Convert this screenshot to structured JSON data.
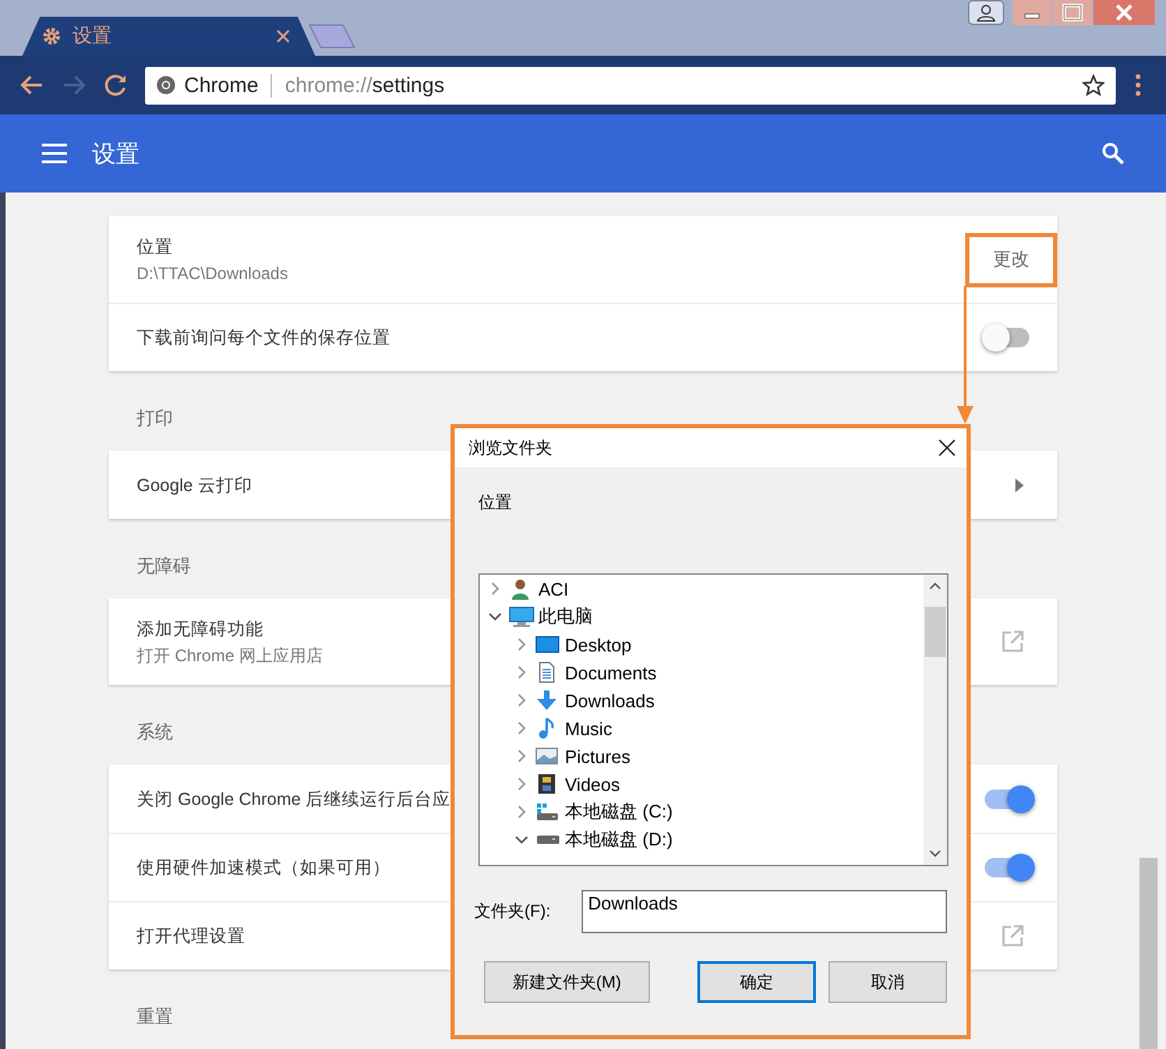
{
  "browser": {
    "tab": {
      "title": "设置"
    },
    "nav": [
      {
        "kind": "back",
        "disabled": false
      },
      {
        "kind": "forward",
        "disabled": true
      },
      {
        "kind": "reload",
        "disabled": false
      }
    ],
    "omnibox": {
      "site": "Chrome",
      "scheme": "chrome://",
      "path": "settings"
    }
  },
  "header": {
    "title": "设置"
  },
  "sections": [
    {
      "rows": [
        {
          "kind": "button",
          "label": "位置",
          "sublabel": "D:\\TTAC\\Downloads",
          "button": "更改",
          "highlighted": true
        },
        {
          "kind": "toggle",
          "label": "下载前询问每个文件的保存位置",
          "on": false
        }
      ]
    },
    {
      "heading": "打印",
      "rows": [
        {
          "kind": "arrow",
          "label": "Google 云打印"
        }
      ]
    },
    {
      "heading": "无障碍",
      "rows": [
        {
          "kind": "external",
          "label": "添加无障碍功能",
          "sublabel": "打开 Chrome 网上应用店"
        }
      ]
    },
    {
      "heading": "系统",
      "rows": [
        {
          "kind": "toggle",
          "label": "关闭 Google Chrome 后继续运行后台应",
          "on": true
        },
        {
          "kind": "toggle",
          "label": "使用硬件加速模式（如果可用）",
          "on": true
        },
        {
          "kind": "external",
          "label": "打开代理设置"
        }
      ]
    },
    {
      "heading": "重置"
    }
  ],
  "dialog": {
    "title": "浏览文件夹",
    "prompt": "位置",
    "tree": [
      {
        "kind": "user",
        "label": "ACI",
        "expanded": false
      },
      {
        "kind": "computer",
        "label": "此电脑",
        "expanded": true,
        "children": [
          {
            "kind": "desktop",
            "label": "Desktop",
            "expanded": false
          },
          {
            "kind": "documents",
            "label": "Documents",
            "expanded": false
          },
          {
            "kind": "downloads",
            "label": "Downloads",
            "expanded": false
          },
          {
            "kind": "music",
            "label": "Music",
            "expanded": false
          },
          {
            "kind": "pictures",
            "label": "Pictures",
            "expanded": false
          },
          {
            "kind": "videos",
            "label": "Videos",
            "expanded": false
          },
          {
            "kind": "drive-windows",
            "label": "本地磁盘 (C:)",
            "expanded": false
          },
          {
            "kind": "drive",
            "label": "本地磁盘 (D:)",
            "expanded": true
          }
        ]
      }
    ],
    "folder_label": "文件夹(F):",
    "folder_value": "Downloads",
    "buttons": [
      {
        "label": "新建文件夹(M)",
        "default": false
      },
      {
        "label": "确定",
        "default": true
      },
      {
        "label": "取消",
        "default": false
      }
    ]
  }
}
